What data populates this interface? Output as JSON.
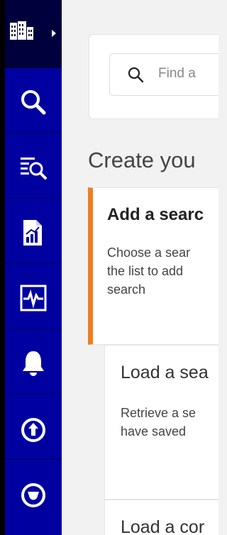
{
  "sidebar": {
    "items": [
      {
        "icon": "building-icon"
      },
      {
        "icon": "search-icon"
      },
      {
        "icon": "search-list-icon"
      },
      {
        "icon": "report-icon"
      },
      {
        "icon": "activity-monitor-icon"
      },
      {
        "icon": "bell-icon"
      },
      {
        "icon": "upload-circle-icon"
      },
      {
        "icon": "chevron-down-circle-icon"
      }
    ]
  },
  "main": {
    "search": {
      "placeholder": "Find a"
    },
    "create_title": "Create you",
    "cards": [
      {
        "title": "Add a searc",
        "desc_lines": [
          "Choose a sear",
          "the list to add",
          "search"
        ]
      },
      {
        "title": "Load a sea",
        "desc_lines": [
          "Retrieve a se",
          "have saved"
        ]
      },
      {
        "title": "Load a cor"
      }
    ]
  },
  "colors": {
    "sidebar": "#0000a0",
    "sidebar_top": "#00003c",
    "accent": "#f07f1e",
    "background": "#f2f2f2"
  }
}
